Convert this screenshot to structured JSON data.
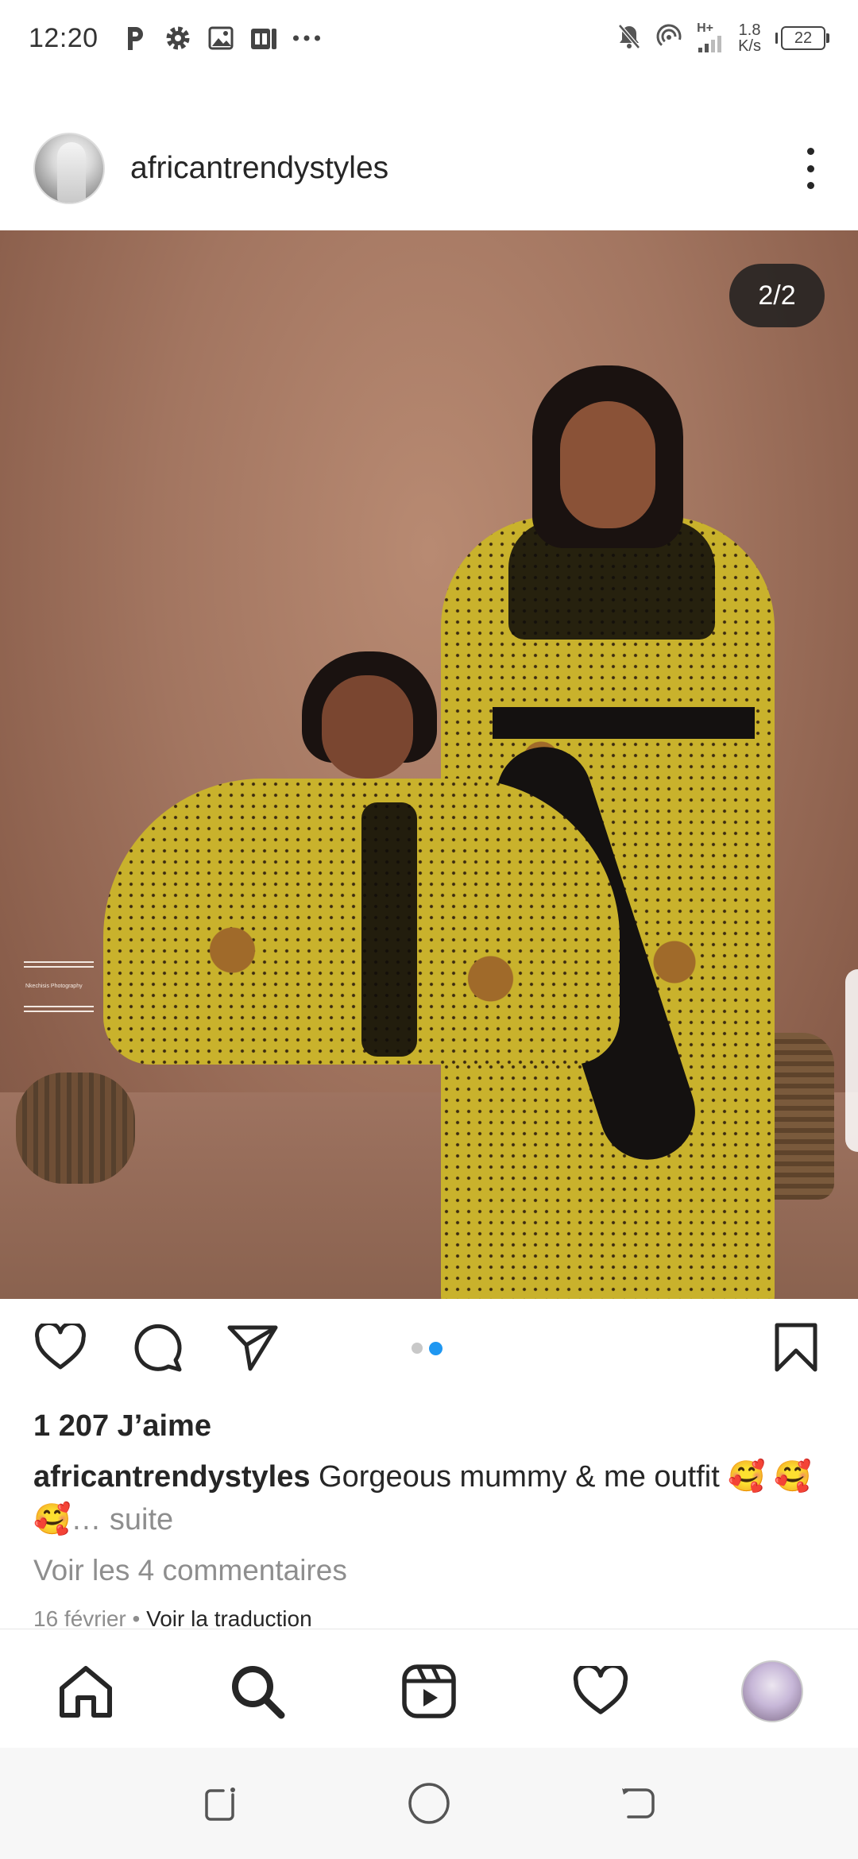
{
  "status_bar": {
    "time": "12:20",
    "left_icons": [
      "parking-icon",
      "settings-icon",
      "gallery-icon",
      "news-icon",
      "more-dots-icon"
    ],
    "net_speed_value": "1.8",
    "net_speed_unit": "K/s",
    "signal_label": "H+",
    "battery": "22"
  },
  "post": {
    "username": "africantrendystyles",
    "page_counter": "2/2",
    "watermark_text": "Nkechisis Photography",
    "carousel_total": 2,
    "carousel_active": 2,
    "likes": "1 207 J’aime",
    "caption_user": "africantrendystyles",
    "caption_text": " Gorgeous mummy & me outfit 🥰 🥰🥰",
    "caption_more": "… suite",
    "view_comments": "Voir les 4 commentaires",
    "date": "16 février",
    "separator": " • ",
    "translate": "Voir la traduction"
  },
  "colors": {
    "text": "#262626",
    "muted": "#8e8e8e",
    "accent_dot": "#1f97f1"
  },
  "bottom_nav": {
    "items": [
      "home-icon",
      "search-icon",
      "reels-icon",
      "activity-heart-icon",
      "profile-avatar"
    ]
  },
  "system_nav": {
    "items": [
      "recent-apps-icon",
      "home-circle-icon",
      "back-icon"
    ]
  }
}
